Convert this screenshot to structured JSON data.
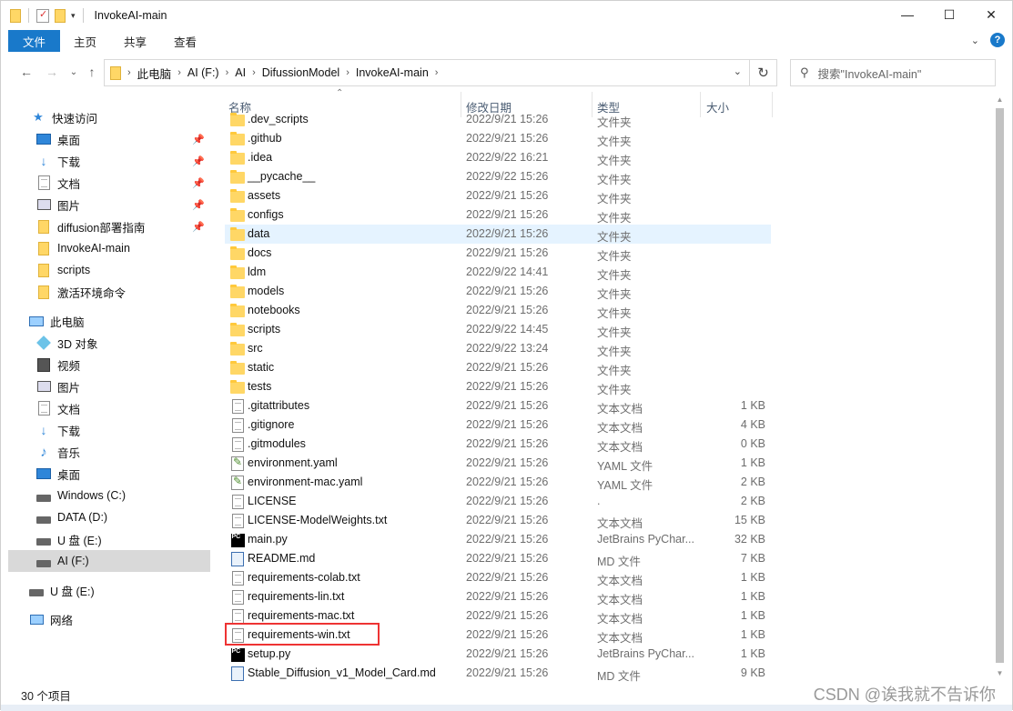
{
  "window": {
    "title": "InvokeAI-main"
  },
  "ribbon": {
    "tabs": [
      "文件",
      "主页",
      "共享",
      "查看"
    ]
  },
  "address": {
    "crumbs": [
      "此电脑",
      "AI (F:)",
      "AI",
      "DifussionModel",
      "InvokeAI-main"
    ]
  },
  "search": {
    "placeholder": "搜索\"InvokeAI-main\""
  },
  "sidebar": {
    "quick_access": "快速访问",
    "quick_items": [
      {
        "label": "桌面",
        "icon": "desktop-icon",
        "pinned": true
      },
      {
        "label": "下载",
        "icon": "download-icon",
        "pinned": true
      },
      {
        "label": "文档",
        "icon": "documents-icon",
        "pinned": true
      },
      {
        "label": "图片",
        "icon": "pictures-icon",
        "pinned": true
      },
      {
        "label": "diffusion部署指南",
        "icon": "folder-icon",
        "pinned": true
      },
      {
        "label": "InvokeAI-main",
        "icon": "folder-icon",
        "pinned": false
      },
      {
        "label": "scripts",
        "icon": "folder-icon",
        "pinned": false
      },
      {
        "label": "激活环境命令",
        "icon": "folder-icon",
        "pinned": false
      }
    ],
    "this_pc": "此电脑",
    "pc_items": [
      {
        "label": "3D 对象",
        "icon": "3d-objects-icon"
      },
      {
        "label": "视频",
        "icon": "video-icon"
      },
      {
        "label": "图片",
        "icon": "pictures-icon"
      },
      {
        "label": "文档",
        "icon": "documents-icon"
      },
      {
        "label": "下载",
        "icon": "download-icon"
      },
      {
        "label": "音乐",
        "icon": "music-icon"
      },
      {
        "label": "桌面",
        "icon": "desktop-icon"
      },
      {
        "label": "Windows (C:)",
        "icon": "drive-icon"
      },
      {
        "label": "DATA (D:)",
        "icon": "drive-icon"
      },
      {
        "label": "U 盘 (E:)",
        "icon": "drive-icon"
      },
      {
        "label": "AI (F:)",
        "icon": "drive-icon"
      }
    ],
    "usb": "U 盘 (E:)",
    "network": "网络"
  },
  "columns": {
    "name": "名称",
    "date": "修改日期",
    "type": "类型",
    "size": "大小"
  },
  "files": [
    {
      "name": ".dev_scripts",
      "date": "2022/9/21 15:26",
      "type": "文件夹",
      "size": "",
      "icon": "folder-icon"
    },
    {
      "name": ".github",
      "date": "2022/9/21 15:26",
      "type": "文件夹",
      "size": "",
      "icon": "folder-icon"
    },
    {
      "name": ".idea",
      "date": "2022/9/22 16:21",
      "type": "文件夹",
      "size": "",
      "icon": "folder-icon"
    },
    {
      "name": "__pycache__",
      "date": "2022/9/22 15:26",
      "type": "文件夹",
      "size": "",
      "icon": "folder-icon"
    },
    {
      "name": "assets",
      "date": "2022/9/21 15:26",
      "type": "文件夹",
      "size": "",
      "icon": "folder-icon"
    },
    {
      "name": "configs",
      "date": "2022/9/21 15:26",
      "type": "文件夹",
      "size": "",
      "icon": "folder-icon"
    },
    {
      "name": "data",
      "date": "2022/9/21 15:26",
      "type": "文件夹",
      "size": "",
      "icon": "folder-icon"
    },
    {
      "name": "docs",
      "date": "2022/9/21 15:26",
      "type": "文件夹",
      "size": "",
      "icon": "folder-icon"
    },
    {
      "name": "ldm",
      "date": "2022/9/22 14:41",
      "type": "文件夹",
      "size": "",
      "icon": "folder-icon"
    },
    {
      "name": "models",
      "date": "2022/9/21 15:26",
      "type": "文件夹",
      "size": "",
      "icon": "folder-icon"
    },
    {
      "name": "notebooks",
      "date": "2022/9/21 15:26",
      "type": "文件夹",
      "size": "",
      "icon": "folder-icon"
    },
    {
      "name": "scripts",
      "date": "2022/9/22 14:45",
      "type": "文件夹",
      "size": "",
      "icon": "folder-icon"
    },
    {
      "name": "src",
      "date": "2022/9/22 13:24",
      "type": "文件夹",
      "size": "",
      "icon": "folder-icon"
    },
    {
      "name": "static",
      "date": "2022/9/21 15:26",
      "type": "文件夹",
      "size": "",
      "icon": "folder-icon"
    },
    {
      "name": "tests",
      "date": "2022/9/21 15:26",
      "type": "文件夹",
      "size": "",
      "icon": "folder-icon"
    },
    {
      "name": ".gitattributes",
      "date": "2022/9/21 15:26",
      "type": "文本文档",
      "size": "1 KB",
      "icon": "text-file-icon"
    },
    {
      "name": ".gitignore",
      "date": "2022/9/21 15:26",
      "type": "文本文档",
      "size": "4 KB",
      "icon": "text-file-icon"
    },
    {
      "name": ".gitmodules",
      "date": "2022/9/21 15:26",
      "type": "文本文档",
      "size": "0 KB",
      "icon": "text-file-icon"
    },
    {
      "name": "environment.yaml",
      "date": "2022/9/21 15:26",
      "type": "YAML 文件",
      "size": "1 KB",
      "icon": "yaml-file-icon"
    },
    {
      "name": "environment-mac.yaml",
      "date": "2022/9/21 15:26",
      "type": "YAML 文件",
      "size": "2 KB",
      "icon": "yaml-file-icon"
    },
    {
      "name": "LICENSE",
      "date": "2022/9/21 15:26",
      "type": ".",
      "size": "2 KB",
      "icon": "text-file-icon"
    },
    {
      "name": "LICENSE-ModelWeights.txt",
      "date": "2022/9/21 15:26",
      "type": "文本文档",
      "size": "15 KB",
      "icon": "text-file-icon"
    },
    {
      "name": "main.py",
      "date": "2022/9/21 15:26",
      "type": "JetBrains PyChar...",
      "size": "32 KB",
      "icon": "pycharm-file-icon"
    },
    {
      "name": "README.md",
      "date": "2022/9/21 15:26",
      "type": "MD 文件",
      "size": "7 KB",
      "icon": "markdown-file-icon"
    },
    {
      "name": "requirements-colab.txt",
      "date": "2022/9/21 15:26",
      "type": "文本文档",
      "size": "1 KB",
      "icon": "text-file-icon"
    },
    {
      "name": "requirements-lin.txt",
      "date": "2022/9/21 15:26",
      "type": "文本文档",
      "size": "1 KB",
      "icon": "text-file-icon"
    },
    {
      "name": "requirements-mac.txt",
      "date": "2022/9/21 15:26",
      "type": "文本文档",
      "size": "1 KB",
      "icon": "text-file-icon"
    },
    {
      "name": "requirements-win.txt",
      "date": "2022/9/21 15:26",
      "type": "文本文档",
      "size": "1 KB",
      "icon": "text-file-icon",
      "highlight": true
    },
    {
      "name": "setup.py",
      "date": "2022/9/21 15:26",
      "type": "JetBrains PyChar...",
      "size": "1 KB",
      "icon": "pycharm-file-icon"
    },
    {
      "name": "Stable_Diffusion_v1_Model_Card.md",
      "date": "2022/9/21 15:26",
      "type": "MD 文件",
      "size": "9 KB",
      "icon": "markdown-file-icon"
    }
  ],
  "selected_row": "data",
  "status": {
    "count": "30 个项目"
  },
  "watermark": "CSDN @诶我就不告诉你",
  "colors": {
    "accent": "#1979ca",
    "selection": "#e5f3ff",
    "highlight_box": "#e33333"
  }
}
